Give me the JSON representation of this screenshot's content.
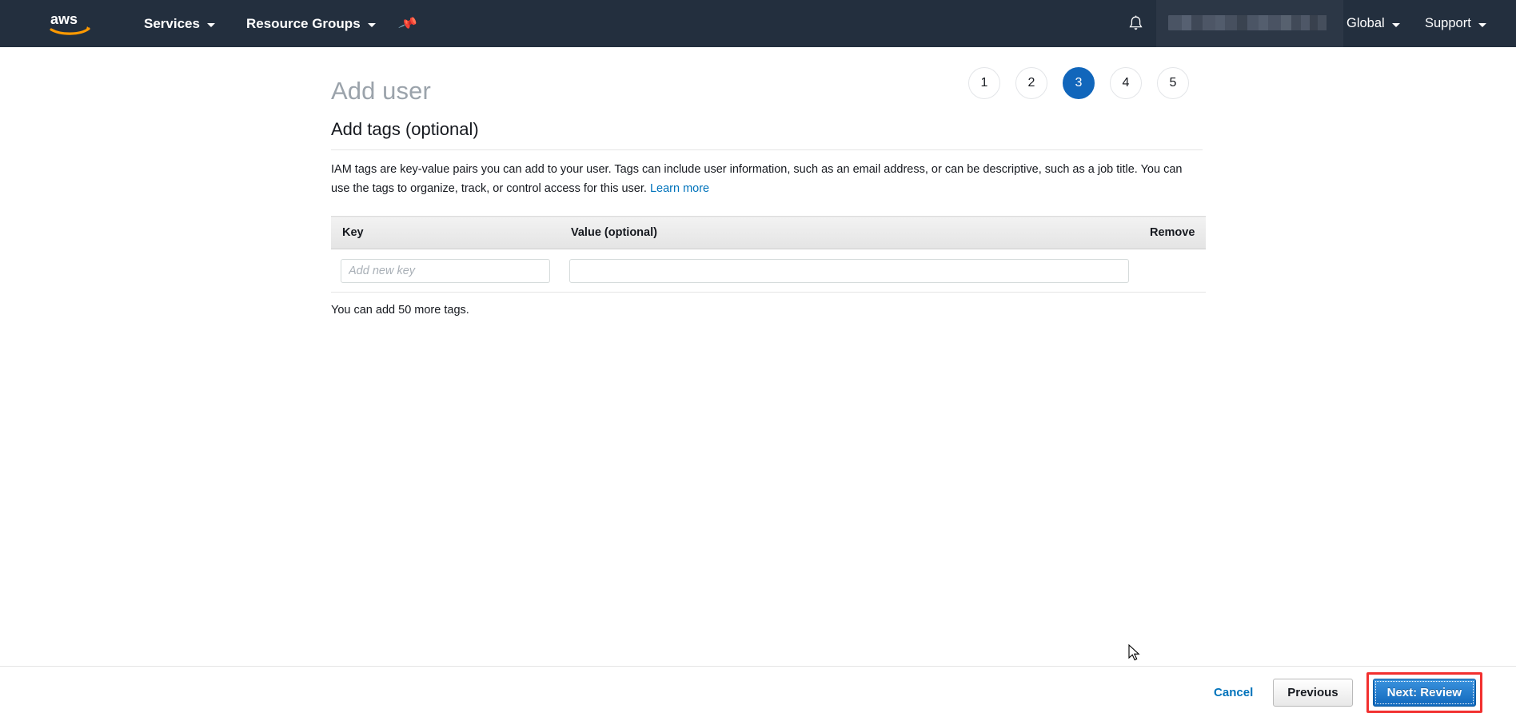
{
  "topnav": {
    "logo_alt": "aws-logo",
    "services_label": "Services",
    "resource_groups_label": "Resource Groups",
    "pin_icon": "pushpin-icon",
    "bell_icon": "bell-icon",
    "account_label": "",
    "region_label": "Global",
    "support_label": "Support",
    "background_color": "#232f3e"
  },
  "header": {
    "title": "Add user"
  },
  "wizard": {
    "steps": [
      "1",
      "2",
      "3",
      "4",
      "5"
    ],
    "active_step": "3",
    "active_color": "#1166bb"
  },
  "main": {
    "section_title": "Add tags (optional)",
    "description": "IAM tags are key-value pairs you can add to your user. Tags can include user information, such as an email address, or can be descriptive, such as a job title. You can use the tags to organize, track, or control access for this user.",
    "learn_more_label": "Learn more",
    "learn_more_color": "#0073bb",
    "table": {
      "columns": [
        "Key",
        "Value (optional)",
        "Remove"
      ],
      "rows": [
        {
          "key_value": "",
          "key_placeholder": "Add new key",
          "value_value": "",
          "value_placeholder": "",
          "remove_label": ""
        }
      ]
    },
    "tags_note": "You can add 50 more tags."
  },
  "footer": {
    "cancel_label": "Cancel",
    "previous_label": "Previous",
    "next_label": "Next: Review",
    "next_highlight_color": "#f2302f",
    "next_button_color": "#1068bd"
  }
}
